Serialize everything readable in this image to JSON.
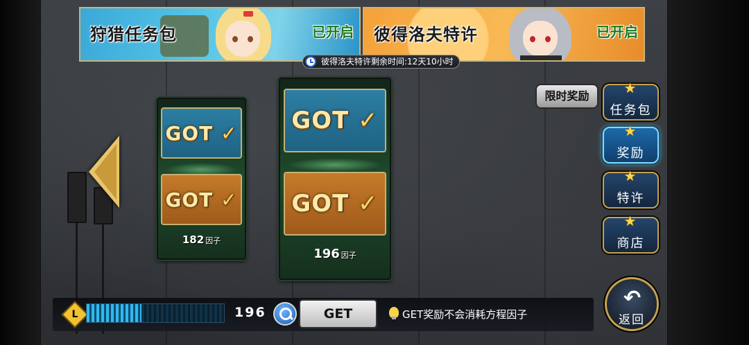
{
  "banners": [
    {
      "title": "狩猎任务包",
      "status": "已开启"
    },
    {
      "title": "彼得洛夫特许",
      "status": "已开启"
    }
  ],
  "timer": {
    "text": "彼得洛夫特许剩余时间:12天10小时",
    "icon": "clock-icon"
  },
  "cards": [
    {
      "top_label": "GOT",
      "bottom_label": "GOT",
      "tick": "✓",
      "amount": "182",
      "unit": "因子"
    },
    {
      "top_label": "GOT",
      "bottom_label": "GOT",
      "tick": "✓",
      "amount": "196",
      "unit": "因子"
    }
  ],
  "side_menu": {
    "limited": "限时奖励",
    "items": [
      {
        "label": "任务包",
        "icon": "star-icon"
      },
      {
        "label": "奖励",
        "icon": "star-icon",
        "active": true
      },
      {
        "label": "特许",
        "icon": "star-icon"
      },
      {
        "label": "商店",
        "icon": "star-icon"
      }
    ],
    "back": "返回",
    "back_icon": "↶"
  },
  "bottom": {
    "level_letter": "L",
    "progress_fraction": 0.4,
    "count": "196",
    "get_label": "GET",
    "info": "GET奖励不会消耗方程因子"
  },
  "colors": {
    "accent_gold": "#c8a24a",
    "active_blue": "#4ec7ff",
    "status_green": "#1a7a1a"
  }
}
